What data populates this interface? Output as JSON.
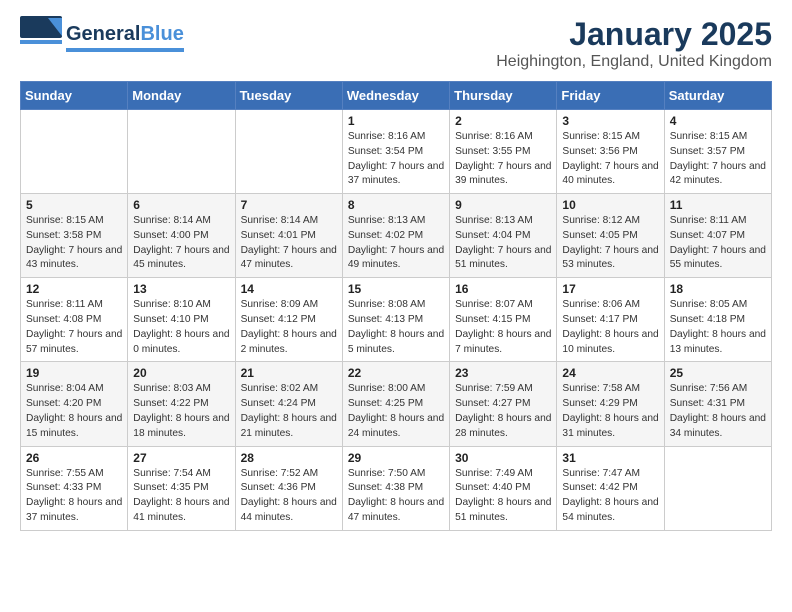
{
  "header": {
    "logo_general": "General",
    "logo_blue": "Blue",
    "title": "January 2025",
    "subtitle": "Heighington, England, United Kingdom"
  },
  "days_of_week": [
    "Sunday",
    "Monday",
    "Tuesday",
    "Wednesday",
    "Thursday",
    "Friday",
    "Saturday"
  ],
  "weeks": [
    [
      {
        "day": "",
        "info": ""
      },
      {
        "day": "",
        "info": ""
      },
      {
        "day": "",
        "info": ""
      },
      {
        "day": "1",
        "info": "Sunrise: 8:16 AM\nSunset: 3:54 PM\nDaylight: 7 hours and 37 minutes."
      },
      {
        "day": "2",
        "info": "Sunrise: 8:16 AM\nSunset: 3:55 PM\nDaylight: 7 hours and 39 minutes."
      },
      {
        "day": "3",
        "info": "Sunrise: 8:15 AM\nSunset: 3:56 PM\nDaylight: 7 hours and 40 minutes."
      },
      {
        "day": "4",
        "info": "Sunrise: 8:15 AM\nSunset: 3:57 PM\nDaylight: 7 hours and 42 minutes."
      }
    ],
    [
      {
        "day": "5",
        "info": "Sunrise: 8:15 AM\nSunset: 3:58 PM\nDaylight: 7 hours and 43 minutes."
      },
      {
        "day": "6",
        "info": "Sunrise: 8:14 AM\nSunset: 4:00 PM\nDaylight: 7 hours and 45 minutes."
      },
      {
        "day": "7",
        "info": "Sunrise: 8:14 AM\nSunset: 4:01 PM\nDaylight: 7 hours and 47 minutes."
      },
      {
        "day": "8",
        "info": "Sunrise: 8:13 AM\nSunset: 4:02 PM\nDaylight: 7 hours and 49 minutes."
      },
      {
        "day": "9",
        "info": "Sunrise: 8:13 AM\nSunset: 4:04 PM\nDaylight: 7 hours and 51 minutes."
      },
      {
        "day": "10",
        "info": "Sunrise: 8:12 AM\nSunset: 4:05 PM\nDaylight: 7 hours and 53 minutes."
      },
      {
        "day": "11",
        "info": "Sunrise: 8:11 AM\nSunset: 4:07 PM\nDaylight: 7 hours and 55 minutes."
      }
    ],
    [
      {
        "day": "12",
        "info": "Sunrise: 8:11 AM\nSunset: 4:08 PM\nDaylight: 7 hours and 57 minutes."
      },
      {
        "day": "13",
        "info": "Sunrise: 8:10 AM\nSunset: 4:10 PM\nDaylight: 8 hours and 0 minutes."
      },
      {
        "day": "14",
        "info": "Sunrise: 8:09 AM\nSunset: 4:12 PM\nDaylight: 8 hours and 2 minutes."
      },
      {
        "day": "15",
        "info": "Sunrise: 8:08 AM\nSunset: 4:13 PM\nDaylight: 8 hours and 5 minutes."
      },
      {
        "day": "16",
        "info": "Sunrise: 8:07 AM\nSunset: 4:15 PM\nDaylight: 8 hours and 7 minutes."
      },
      {
        "day": "17",
        "info": "Sunrise: 8:06 AM\nSunset: 4:17 PM\nDaylight: 8 hours and 10 minutes."
      },
      {
        "day": "18",
        "info": "Sunrise: 8:05 AM\nSunset: 4:18 PM\nDaylight: 8 hours and 13 minutes."
      }
    ],
    [
      {
        "day": "19",
        "info": "Sunrise: 8:04 AM\nSunset: 4:20 PM\nDaylight: 8 hours and 15 minutes."
      },
      {
        "day": "20",
        "info": "Sunrise: 8:03 AM\nSunset: 4:22 PM\nDaylight: 8 hours and 18 minutes."
      },
      {
        "day": "21",
        "info": "Sunrise: 8:02 AM\nSunset: 4:24 PM\nDaylight: 8 hours and 21 minutes."
      },
      {
        "day": "22",
        "info": "Sunrise: 8:00 AM\nSunset: 4:25 PM\nDaylight: 8 hours and 24 minutes."
      },
      {
        "day": "23",
        "info": "Sunrise: 7:59 AM\nSunset: 4:27 PM\nDaylight: 8 hours and 28 minutes."
      },
      {
        "day": "24",
        "info": "Sunrise: 7:58 AM\nSunset: 4:29 PM\nDaylight: 8 hours and 31 minutes."
      },
      {
        "day": "25",
        "info": "Sunrise: 7:56 AM\nSunset: 4:31 PM\nDaylight: 8 hours and 34 minutes."
      }
    ],
    [
      {
        "day": "26",
        "info": "Sunrise: 7:55 AM\nSunset: 4:33 PM\nDaylight: 8 hours and 37 minutes."
      },
      {
        "day": "27",
        "info": "Sunrise: 7:54 AM\nSunset: 4:35 PM\nDaylight: 8 hours and 41 minutes."
      },
      {
        "day": "28",
        "info": "Sunrise: 7:52 AM\nSunset: 4:36 PM\nDaylight: 8 hours and 44 minutes."
      },
      {
        "day": "29",
        "info": "Sunrise: 7:50 AM\nSunset: 4:38 PM\nDaylight: 8 hours and 47 minutes."
      },
      {
        "day": "30",
        "info": "Sunrise: 7:49 AM\nSunset: 4:40 PM\nDaylight: 8 hours and 51 minutes."
      },
      {
        "day": "31",
        "info": "Sunrise: 7:47 AM\nSunset: 4:42 PM\nDaylight: 8 hours and 54 minutes."
      },
      {
        "day": "",
        "info": ""
      }
    ]
  ]
}
